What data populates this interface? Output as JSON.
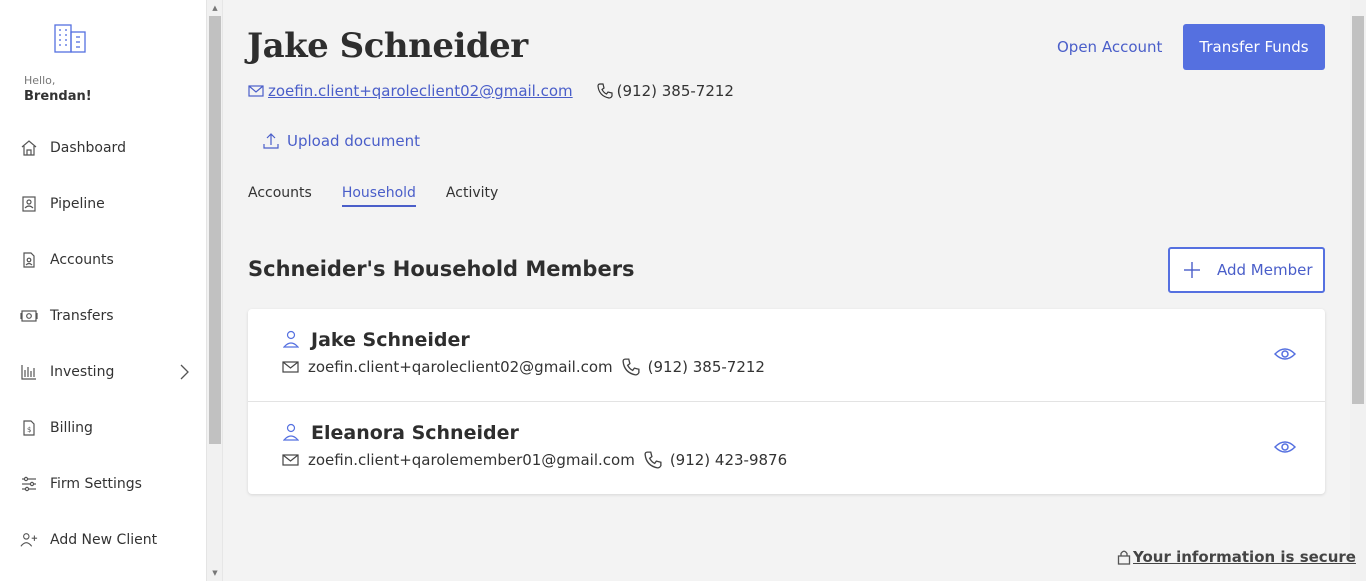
{
  "sidebar": {
    "greeting": "Hello,",
    "user_name": "Brendan!",
    "items": [
      {
        "label": "Dashboard",
        "icon": "home-icon"
      },
      {
        "label": "Pipeline",
        "icon": "pipeline-icon"
      },
      {
        "label": "Accounts",
        "icon": "accounts-icon"
      },
      {
        "label": "Transfers",
        "icon": "transfers-icon"
      },
      {
        "label": "Investing",
        "icon": "investing-icon"
      },
      {
        "label": "Billing",
        "icon": "billing-icon"
      },
      {
        "label": "Firm Settings",
        "icon": "sliders-icon"
      },
      {
        "label": "Add New Client",
        "icon": "add-user-icon"
      }
    ]
  },
  "client": {
    "name": "Jake Schneider",
    "email": "zoefin.client+qaroleclient02@gmail.com",
    "phone": "(912) 385-7212"
  },
  "actions": {
    "open_account": "Open Account",
    "transfer_funds": "Transfer Funds",
    "upload_document": "Upload document",
    "add_member": "Add Member"
  },
  "tabs": [
    {
      "label": "Accounts",
      "active": false
    },
    {
      "label": "Household",
      "active": true
    },
    {
      "label": "Activity",
      "active": false
    }
  ],
  "household": {
    "title": "Schneider's Household Members",
    "members": [
      {
        "name": "Jake Schneider",
        "email": "zoefin.client+qaroleclient02@gmail.com",
        "phone": "(912) 385-7212"
      },
      {
        "name": "Eleanora Schneider",
        "email": "zoefin.client+qarolemember01@gmail.com",
        "phone": "(912) 423-9876"
      }
    ]
  },
  "footer": {
    "secure": "Your information is secure"
  },
  "colors": {
    "accent": "#5570e0",
    "link": "#4a5ec9",
    "background": "#f3f3f3"
  }
}
